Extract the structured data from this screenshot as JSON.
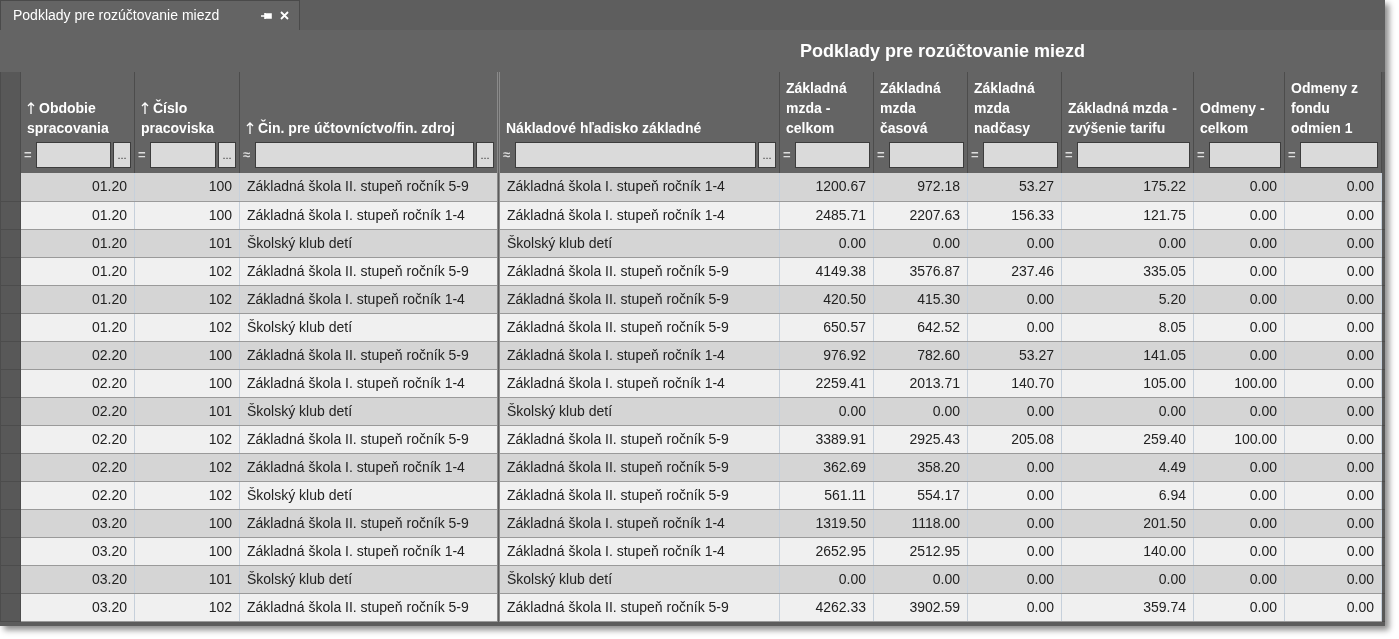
{
  "tab": {
    "label": "Podklady pre rozúčtovanie miezd",
    "selected": true
  },
  "title": "Podklady pre rozúčtovanie miezd",
  "columns": [
    {
      "label": "Obdobie spracovania",
      "sorted": true,
      "kind": "numeric",
      "filter_operator": "=",
      "picker": "..."
    },
    {
      "label": "Číslo pracoviska",
      "sorted": true,
      "kind": "numeric",
      "filter_operator": "=",
      "picker": "..."
    },
    {
      "label": "Čin. pre účtovníctvo/fin. zdroj",
      "sorted": true,
      "kind": "text",
      "filter_operator": "≈",
      "picker": "..."
    },
    {
      "label": "Nákladové hľadisko základné",
      "sorted": false,
      "kind": "text",
      "filter_operator": "≈",
      "picker": "..."
    },
    {
      "label": "Základná mzda - celkom",
      "sorted": false,
      "kind": "numeric",
      "filter_operator": "="
    },
    {
      "label": "Základná mzda časová",
      "sorted": false,
      "kind": "numeric",
      "filter_operator": "="
    },
    {
      "label": "Základná mzda nadčasy",
      "sorted": false,
      "kind": "numeric",
      "filter_operator": "="
    },
    {
      "label": "Základná mzda - zvýšenie tarifu",
      "sorted": false,
      "kind": "numeric",
      "filter_operator": "="
    },
    {
      "label": "Odmeny - celkom",
      "sorted": false,
      "kind": "numeric",
      "filter_operator": "="
    },
    {
      "label": "Odmeny z fondu odmien 1",
      "sorted": false,
      "kind": "numeric",
      "filter_operator": "="
    }
  ],
  "rows": [
    [
      "01.20",
      "100",
      "Základná škola II. stupeň ročník 5-9",
      "Základná škola I. stupeň ročník 1-4",
      "1200.67",
      "972.18",
      "53.27",
      "175.22",
      "0.00",
      "0.00"
    ],
    [
      "01.20",
      "100",
      "Základná škola I. stupeň ročník 1-4",
      "Základná škola I. stupeň ročník 1-4",
      "2485.71",
      "2207.63",
      "156.33",
      "121.75",
      "0.00",
      "0.00"
    ],
    [
      "01.20",
      "101",
      "Školský klub detí",
      "Školský klub detí",
      "0.00",
      "0.00",
      "0.00",
      "0.00",
      "0.00",
      "0.00"
    ],
    [
      "01.20",
      "102",
      "Základná škola II. stupeň ročník 5-9",
      "Základná škola II. stupeň ročník 5-9",
      "4149.38",
      "3576.87",
      "237.46",
      "335.05",
      "0.00",
      "0.00"
    ],
    [
      "01.20",
      "102",
      "Základná škola I. stupeň ročník 1-4",
      "Základná škola II. stupeň ročník 5-9",
      "420.50",
      "415.30",
      "0.00",
      "5.20",
      "0.00",
      "0.00"
    ],
    [
      "01.20",
      "102",
      "Školský klub detí",
      "Základná škola II. stupeň ročník 5-9",
      "650.57",
      "642.52",
      "0.00",
      "8.05",
      "0.00",
      "0.00"
    ],
    [
      "02.20",
      "100",
      "Základná škola II. stupeň ročník 5-9",
      "Základná škola I. stupeň ročník 1-4",
      "976.92",
      "782.60",
      "53.27",
      "141.05",
      "0.00",
      "0.00"
    ],
    [
      "02.20",
      "100",
      "Základná škola I. stupeň ročník 1-4",
      "Základná škola I. stupeň ročník 1-4",
      "2259.41",
      "2013.71",
      "140.70",
      "105.00",
      "100.00",
      "0.00"
    ],
    [
      "02.20",
      "101",
      "Školský klub detí",
      "Školský klub detí",
      "0.00",
      "0.00",
      "0.00",
      "0.00",
      "0.00",
      "0.00"
    ],
    [
      "02.20",
      "102",
      "Základná škola II. stupeň ročník 5-9",
      "Základná škola II. stupeň ročník 5-9",
      "3389.91",
      "2925.43",
      "205.08",
      "259.40",
      "100.00",
      "0.00"
    ],
    [
      "02.20",
      "102",
      "Základná škola I. stupeň ročník 1-4",
      "Základná škola II. stupeň ročník 5-9",
      "362.69",
      "358.20",
      "0.00",
      "4.49",
      "0.00",
      "0.00"
    ],
    [
      "02.20",
      "102",
      "Školský klub detí",
      "Základná škola II. stupeň ročník 5-9",
      "561.11",
      "554.17",
      "0.00",
      "6.94",
      "0.00",
      "0.00"
    ],
    [
      "03.20",
      "100",
      "Základná škola II. stupeň ročník 5-9",
      "Základná škola I. stupeň ročník 1-4",
      "1319.50",
      "1118.00",
      "0.00",
      "201.50",
      "0.00",
      "0.00"
    ],
    [
      "03.20",
      "100",
      "Základná škola I. stupeň ročník 1-4",
      "Základná škola I. stupeň ročník 1-4",
      "2652.95",
      "2512.95",
      "0.00",
      "140.00",
      "0.00",
      "0.00"
    ],
    [
      "03.20",
      "101",
      "Školský klub detí",
      "Školský klub detí",
      "0.00",
      "0.00",
      "0.00",
      "0.00",
      "0.00",
      "0.00"
    ],
    [
      "03.20",
      "102",
      "Základná škola II. stupeň ročník 5-9",
      "Základná škola II. stupeň ročník 5-9",
      "4262.33",
      "3902.59",
      "0.00",
      "359.74",
      "0.00",
      "0.00"
    ]
  ]
}
